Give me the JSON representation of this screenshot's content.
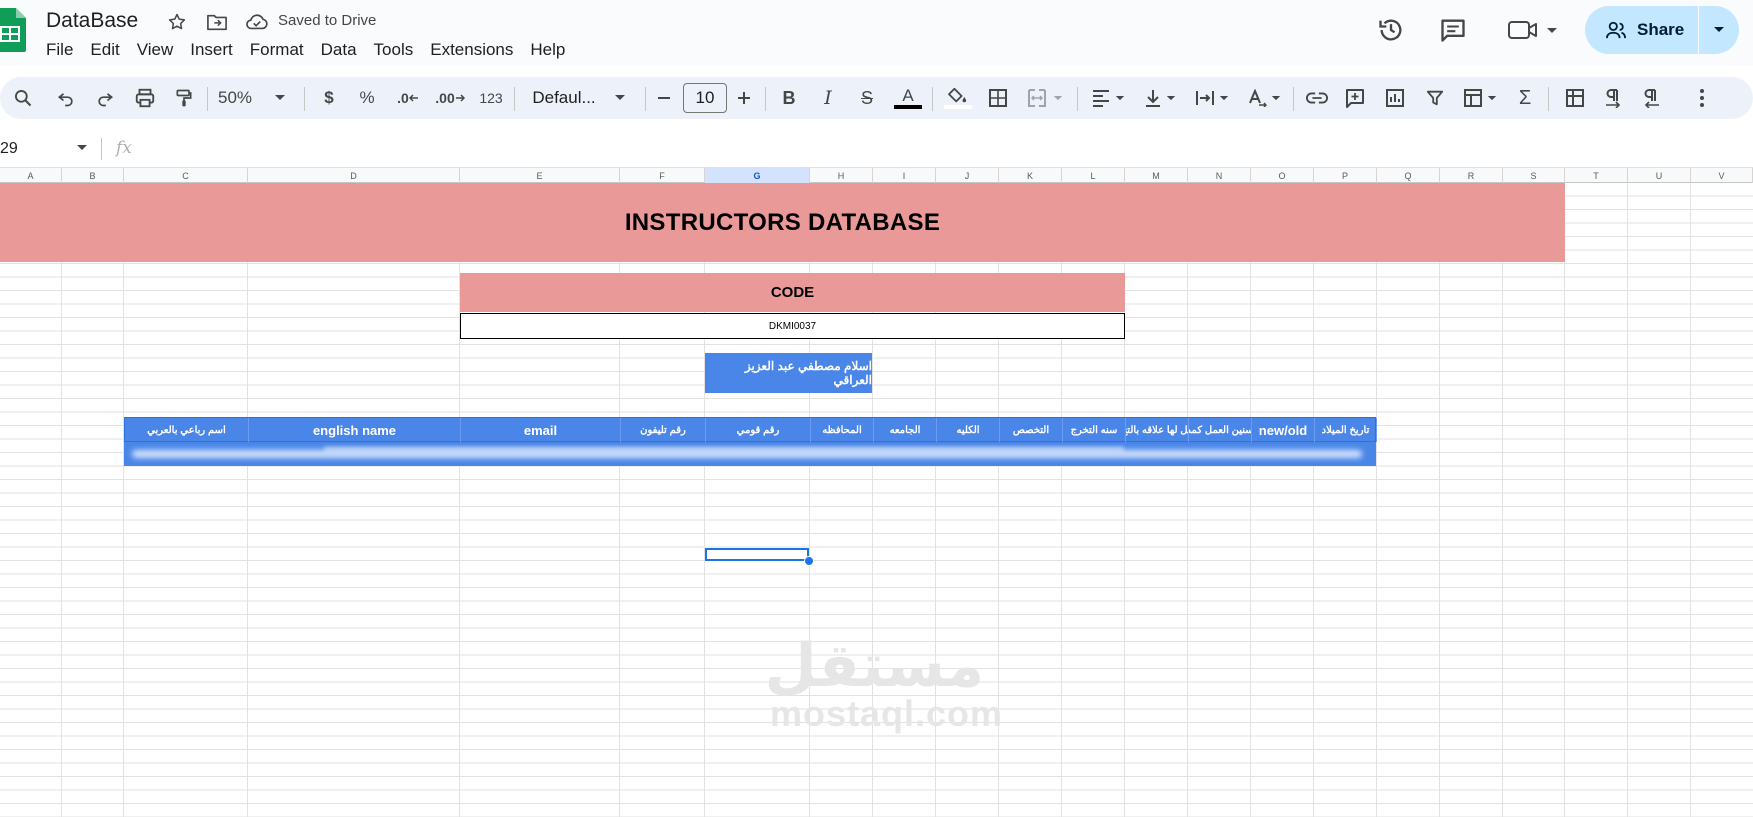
{
  "app": {
    "doc_title": "DataBase",
    "saved_status": "Saved to Drive",
    "menu": [
      "File",
      "Edit",
      "View",
      "Insert",
      "Format",
      "Data",
      "Tools",
      "Extensions",
      "Help"
    ],
    "share_label": "Share",
    "accent_color": "#c2e7ff"
  },
  "toolbar": {
    "zoom": "50%",
    "currency": "$",
    "percent": "%",
    "decrease_decimal": ".0",
    "increase_decimal": ".00",
    "number_format": "123",
    "font_family": "Defaul...",
    "font_size": "10",
    "bold": "B",
    "italic": "I",
    "strike": "S",
    "text_color": "A",
    "sigma": "Σ"
  },
  "formula_bar": {
    "name_box": "29",
    "fx": "fx"
  },
  "sheet": {
    "columns": [
      "A",
      "B",
      "C",
      "D",
      "E",
      "F",
      "G",
      "H",
      "I",
      "J",
      "K",
      "L",
      "M",
      "N",
      "O",
      "P",
      "Q",
      "R",
      "S",
      "T",
      "U",
      "V"
    ],
    "selected_column": "G",
    "banner_title": "INSTRUCTORS DATABASE",
    "banner_color": "#ea9999",
    "code_label": "CODE",
    "code_value": "DKMI0037",
    "instructor_name": "اسلام مصطفي عبد العزيز العراقي",
    "header_color": "#4a86e8",
    "table_headers": [
      "اسم رباعي بالعربي",
      "english name",
      "email",
      "رقم تليفون",
      "رقم قومي",
      "المحافظه",
      "الجامعه",
      "الكليه",
      "التخصص",
      "سنه التخرج",
      "هل لها علاقه بالتخ",
      "سنين العمل كمد",
      "new/old",
      "تاريخ الميلاد"
    ],
    "watermark_ar": "مستقل",
    "watermark_en": "mostaql.com"
  }
}
